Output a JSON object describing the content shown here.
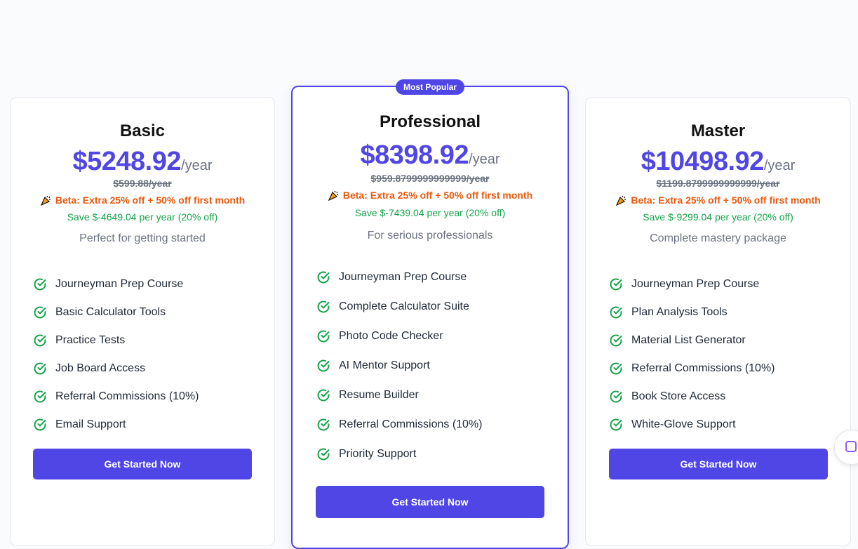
{
  "colors": {
    "accent": "#4f46e5",
    "beta": "#ea580c",
    "save": "#16a34a",
    "muted": "#6b7280",
    "check": "#16a34a"
  },
  "plans": [
    {
      "name": "Basic",
      "price": "$5248.92",
      "period": "/year",
      "old_price": "$599.88/year",
      "beta": "Beta: Extra 25% off + 50% off first month",
      "save": "Save $-4649.04 per year (20% off)",
      "description": "Perfect for getting started",
      "features": [
        "Journeyman Prep Course",
        "Basic Calculator Tools",
        "Practice Tests",
        "Job Board Access",
        "Referral Commissions (10%)",
        "Email Support"
      ],
      "cta": "Get Started Now"
    },
    {
      "badge": "Most Popular",
      "name": "Professional",
      "price": "$8398.92",
      "period": "/year",
      "old_price": "$959.8799999999999/year",
      "beta": "Beta: Extra 25% off + 50% off first month",
      "save": "Save $-7439.04 per year (20% off)",
      "description": "For serious professionals",
      "features": [
        "Journeyman Prep Course",
        "Complete Calculator Suite",
        "Photo Code Checker",
        "AI Mentor Support",
        "Resume Builder",
        "Referral Commissions (10%)",
        "Priority Support"
      ],
      "cta": "Get Started Now"
    },
    {
      "name": "Master",
      "price": "$10498.92",
      "period": "/year",
      "old_price": "$1199.8799999999999/year",
      "beta": "Beta: Extra 25% off + 50% off first month",
      "save": "Save $-9299.04 per year (20% off)",
      "description": "Complete mastery package",
      "features": [
        "Journeyman Prep Course",
        "Plan Analysis Tools",
        "Material List Generator",
        "Referral Commissions (10%)",
        "Book Store Access",
        "White-Glove Support"
      ],
      "cta": "Get Started Now"
    }
  ],
  "icons": {
    "feature": "check-circle-icon",
    "beta": "party-popper-icon",
    "floating": "widget-icon"
  }
}
